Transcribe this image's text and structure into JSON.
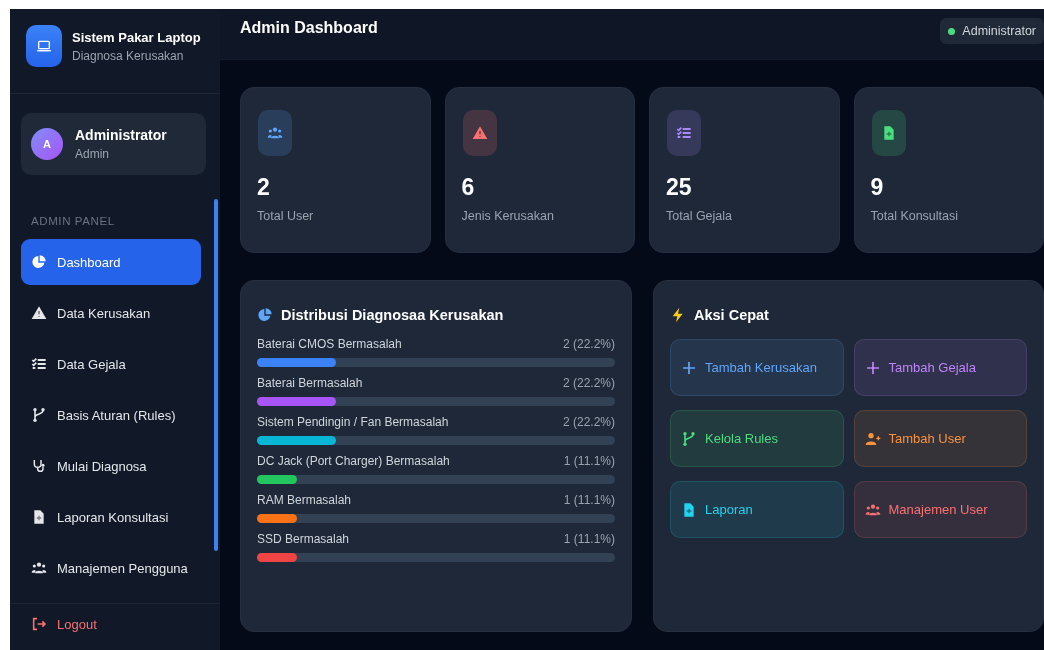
{
  "brand": {
    "title": "Sistem Pakar Laptop",
    "subtitle": "Diagnosa Kerusakan"
  },
  "user": {
    "initial": "A",
    "name": "Administrator",
    "role": "Admin"
  },
  "nav_section": "ADMIN PANEL",
  "nav": [
    {
      "label": "Dashboard",
      "kind": "pie",
      "selected": true
    },
    {
      "label": "Data Kerusakan",
      "kind": "warn",
      "selected": false
    },
    {
      "label": "Data Gejala",
      "kind": "list",
      "selected": false
    },
    {
      "label": "Basis Aturan (Rules)",
      "kind": "branch",
      "selected": false
    },
    {
      "label": "Mulai Diagnosa",
      "kind": "steth",
      "selected": false
    },
    {
      "label": "Laporan Konsultasi",
      "kind": "file",
      "selected": false
    },
    {
      "label": "Manajemen Pengguna",
      "kind": "users",
      "selected": false
    }
  ],
  "logout": {
    "label": "Logout"
  },
  "header": {
    "title": "Admin Dashboard",
    "status": {
      "label": "Administrator",
      "online": true
    }
  },
  "stats": [
    {
      "value": "2",
      "label": "Total User",
      "kind": "users",
      "color": "#60a5fa"
    },
    {
      "value": "6",
      "label": "Jenis Kerusakan",
      "kind": "warn",
      "color": "#f87171"
    },
    {
      "value": "25",
      "label": "Total Gejala",
      "kind": "list",
      "color": "#a78bfa"
    },
    {
      "value": "9",
      "label": "Total Konsultasi",
      "kind": "file",
      "color": "#4ade80"
    }
  ],
  "distribution": {
    "title": "Distribusi Diagnosaa Kerusakan",
    "items": [
      {
        "name": "Baterai CMOS Bermasalah",
        "count": "2 (22.2%)",
        "level": 0.222,
        "color": "#3b82f6"
      },
      {
        "name": "Baterai Bermasalah",
        "count": "2 (22.2%)",
        "level": 0.222,
        "color": "#a855f7"
      },
      {
        "name": "Sistem Pendingin / Fan Bermasalah",
        "count": "2 (22.2%)",
        "level": 0.222,
        "color": "#06b6d4"
      },
      {
        "name": "DC Jack (Port Charger) Bermasalah",
        "count": "1 (11.1%)",
        "level": 0.111,
        "color": "#22c55e"
      },
      {
        "name": "RAM Bermasalah",
        "count": "1 (11.1%)",
        "level": 0.111,
        "color": "#f97316"
      },
      {
        "name": "SSD Bermasalah",
        "count": "1 (11.1%)",
        "level": 0.111,
        "color": "#ef4444"
      }
    ]
  },
  "quick": {
    "title": "Aksi Cepat",
    "actions": [
      {
        "label": "Tambah Kerusakan",
        "kind": "plus",
        "color": "#60a5fa"
      },
      {
        "label": "Tambah Gejala",
        "kind": "plus",
        "color": "#c084fc"
      },
      {
        "label": "Kelola Rules",
        "kind": "branch",
        "color": "#4ade80"
      },
      {
        "label": "Tambah User",
        "kind": "userplus",
        "color": "#fb923c"
      },
      {
        "label": "Laporan",
        "kind": "file",
        "color": "#22d3ee"
      },
      {
        "label": "Manajemen User",
        "kind": "users",
        "color": "#f87171"
      }
    ]
  }
}
